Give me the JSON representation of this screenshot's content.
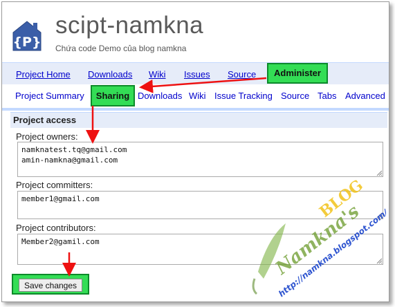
{
  "header": {
    "title": "scipt-namkna",
    "subtitle": "Chứa code Demo của blog namkna"
  },
  "main_nav": {
    "items": [
      "Project Home",
      "Downloads",
      "Wiki",
      "Issues",
      "Source"
    ],
    "active": "Administer"
  },
  "sub_nav": {
    "items": [
      "Project Summary",
      "Downloads",
      "Wiki",
      "Issue Tracking",
      "Source",
      "Tabs",
      "Advanced"
    ],
    "active": "Sharing"
  },
  "section": {
    "title": "Project access"
  },
  "fields": {
    "owners": {
      "label": "Project owners:",
      "value": "namknatest.tq@gmail.com\namin-namkna@gmail.com"
    },
    "committers": {
      "label": "Project committers:",
      "value": "member1@gmail.com"
    },
    "contributors": {
      "label": "Project contributors:",
      "value": "Member2@gamil.com"
    }
  },
  "save_label": "Save changes",
  "watermark": {
    "name": "Namkna's",
    "blog": "BLOG",
    "url": "http://namkna.blogspot.com/"
  },
  "colors": {
    "highlight": "#33dd55",
    "arrow": "#ee1111",
    "link": "#0000cc",
    "nav_bg": "#e6ecf9"
  }
}
